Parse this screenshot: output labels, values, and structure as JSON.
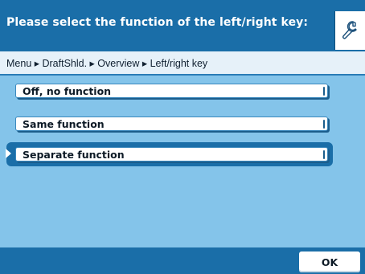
{
  "header": {
    "title": "Please select the function of the left/right key:",
    "tool_icon": "wrench-icon"
  },
  "breadcrumb": {
    "text": "Menu ▸ DraftShld. ▸ Overview ▸ Left/right key"
  },
  "options": [
    {
      "label": "Off, no function",
      "selected": false
    },
    {
      "label": "Same function",
      "selected": false
    },
    {
      "label": "Separate function",
      "selected": true
    }
  ],
  "footer": {
    "ok_label": "OK"
  },
  "colors": {
    "header_bg": "#1a6ea8",
    "screen_bg": "#84c4ea",
    "breadcrumb_bg": "#e6f1f9",
    "button_bg": "#ffffff"
  }
}
